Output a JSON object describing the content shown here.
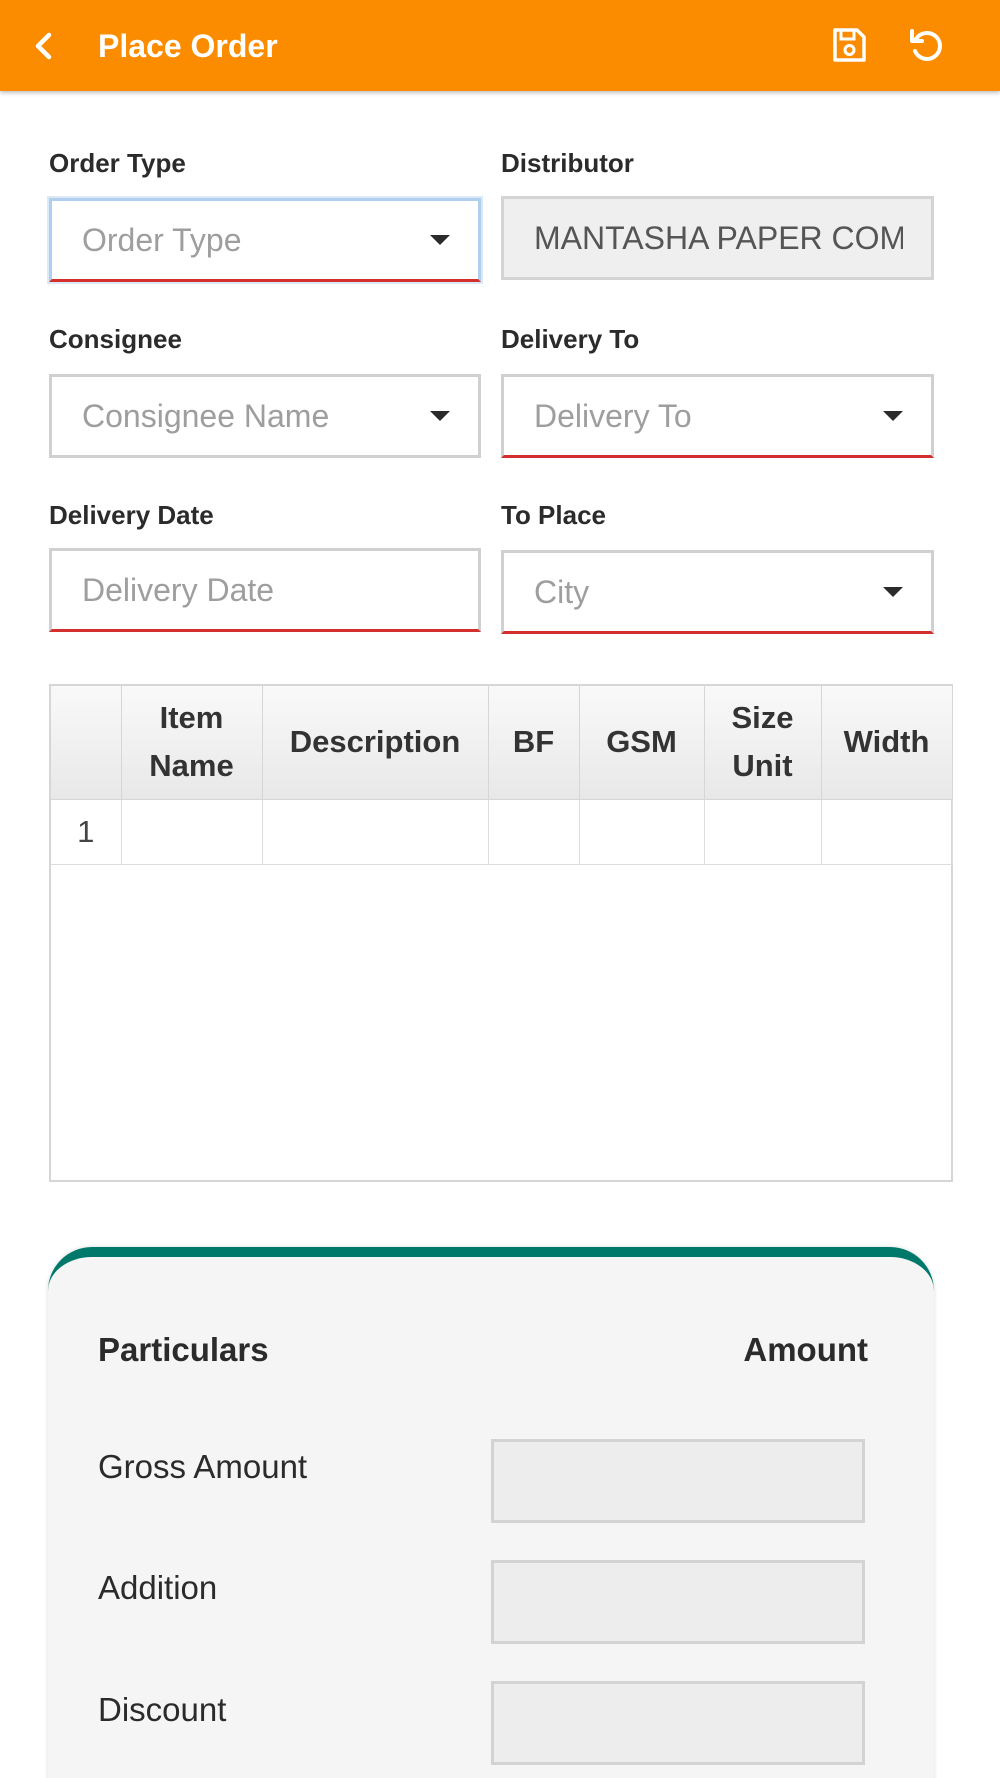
{
  "appbar": {
    "title": "Place Order",
    "icons": {
      "back": "back-arrow-icon",
      "save": "save-icon",
      "refresh": "refresh-icon"
    },
    "color": "#fb8c00"
  },
  "form": {
    "order_type": {
      "label": "Order Type",
      "placeholder": "Order Type"
    },
    "distributor": {
      "label": "Distributor",
      "value": "MANTASHA PAPER COMPANY"
    },
    "consignee": {
      "label": "Consignee",
      "placeholder": "Consignee Name"
    },
    "delivery_to": {
      "label": "Delivery To",
      "placeholder": "Delivery To"
    },
    "delivery_date": {
      "label": "Delivery Date",
      "placeholder": "Delivery Date"
    },
    "to_place": {
      "label": "To Place",
      "placeholder": "City"
    }
  },
  "grid": {
    "columns": [
      "",
      "Item Name",
      "Description",
      "BF",
      "GSM",
      "Size Unit",
      "Width"
    ],
    "rows": [
      {
        "num": "1"
      }
    ]
  },
  "summary": {
    "header_particulars": "Particulars",
    "header_amount": "Amount",
    "rows": [
      {
        "label": "Gross Amount",
        "value": ""
      },
      {
        "label": "Addition",
        "value": ""
      },
      {
        "label": "Discount",
        "value": ""
      }
    ],
    "accent": "#00796b"
  },
  "colors": {
    "invalid": "#d32f2f"
  }
}
